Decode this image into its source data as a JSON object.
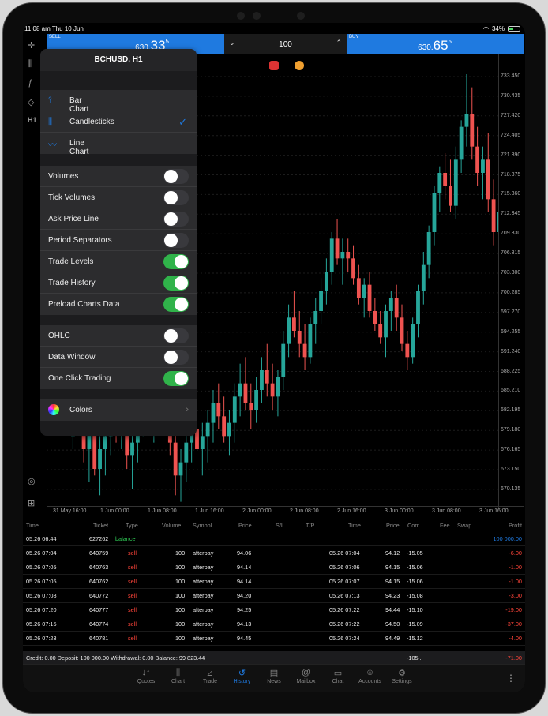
{
  "status": {
    "time": "11:08 am",
    "date": "Thu 10 Jun",
    "battery": "34%"
  },
  "trade": {
    "sell_label": "SELL",
    "sell_small": "630.",
    "sell_big": "33",
    "sell_sup": "5",
    "buy_label": "BUY",
    "buy_small": "630.",
    "buy_big": "65",
    "buy_sup": "5",
    "volume": "100"
  },
  "popover": {
    "title": "BCHUSD, H1",
    "chart_types": [
      {
        "label": "Bar Chart",
        "icon": "bar-chart-icon",
        "selected": false
      },
      {
        "label": "Candlesticks",
        "icon": "candlestick-icon",
        "selected": true
      },
      {
        "label": "Line Chart",
        "icon": "line-chart-icon",
        "selected": false
      }
    ],
    "options": [
      {
        "label": "Volumes",
        "on": false
      },
      {
        "label": "Tick Volumes",
        "on": false
      },
      {
        "label": "Ask Price Line",
        "on": false
      },
      {
        "label": "Period Separators",
        "on": false
      },
      {
        "label": "Trade Levels",
        "on": true
      },
      {
        "label": "Trade History",
        "on": true
      },
      {
        "label": "Preload Charts Data",
        "on": true
      }
    ],
    "options2": [
      {
        "label": "OHLC",
        "on": false
      },
      {
        "label": "Data Window",
        "on": false
      },
      {
        "label": "One Click Trading",
        "on": true
      }
    ],
    "colors_label": "Colors"
  },
  "left_tools": [
    "crosshair-icon",
    "indicators-icon",
    "function-icon",
    "objects-icon",
    "H1"
  ],
  "price_axis": [
    "733.450",
    "730.435",
    "727.420",
    "724.405",
    "721.390",
    "718.375",
    "715.360",
    "712.345",
    "709.330",
    "706.315",
    "703.300",
    "700.285",
    "697.270",
    "694.255",
    "691.240",
    "688.225",
    "685.210",
    "682.195",
    "679.180",
    "676.165",
    "673.150",
    "670.135"
  ],
  "time_axis": [
    "31 May 16:00",
    "1 Jun 00:00",
    "1 Jun 08:00",
    "1 Jun 16:00",
    "2 Jun 00:00",
    "2 Jun 08:00",
    "2 Jun 16:00",
    "3 Jun 00:00",
    "3 Jun 08:00",
    "3 Jun 16:00"
  ],
  "chart_data": {
    "type": "candlestick",
    "symbol": "BCHUSD",
    "timeframe": "H1",
    "ylim": [
      667.0,
      736.0
    ],
    "candles": [
      [
        678,
        684,
        676,
        682
      ],
      [
        682,
        688,
        679,
        681
      ],
      [
        681,
        683,
        674,
        676
      ],
      [
        676,
        680,
        671,
        679
      ],
      [
        679,
        681,
        672,
        673
      ],
      [
        673,
        678,
        669,
        676
      ],
      [
        676,
        680,
        672,
        678
      ],
      [
        678,
        683,
        675,
        680
      ],
      [
        680,
        684,
        677,
        679
      ],
      [
        679,
        682,
        676,
        681
      ],
      [
        681,
        683,
        673,
        675
      ],
      [
        675,
        679,
        670,
        677
      ],
      [
        677,
        681,
        674,
        680
      ],
      [
        680,
        686,
        678,
        684
      ],
      [
        684,
        687,
        680,
        681
      ],
      [
        681,
        685,
        677,
        683
      ],
      [
        683,
        687,
        679,
        685
      ],
      [
        685,
        688,
        681,
        682
      ],
      [
        682,
        684,
        675,
        677
      ],
      [
        677,
        679,
        669,
        672
      ],
      [
        672,
        676,
        668,
        674
      ],
      [
        674,
        679,
        671,
        677
      ],
      [
        677,
        681,
        674,
        679
      ],
      [
        679,
        683,
        675,
        676
      ],
      [
        676,
        680,
        672,
        678
      ],
      [
        678,
        682,
        674,
        680
      ],
      [
        680,
        685,
        677,
        683
      ],
      [
        683,
        686,
        679,
        681
      ],
      [
        681,
        684,
        677,
        678
      ],
      [
        678,
        682,
        675,
        680
      ],
      [
        680,
        686,
        677,
        684
      ],
      [
        684,
        689,
        681,
        686
      ],
      [
        686,
        690,
        682,
        683
      ],
      [
        683,
        686,
        679,
        682
      ],
      [
        682,
        687,
        680,
        685
      ],
      [
        685,
        690,
        683,
        688
      ],
      [
        688,
        692,
        684,
        686
      ],
      [
        686,
        689,
        682,
        684
      ],
      [
        684,
        688,
        681,
        687
      ],
      [
        687,
        694,
        685,
        692
      ],
      [
        692,
        698,
        690,
        696
      ],
      [
        696,
        700,
        693,
        694
      ],
      [
        694,
        697,
        690,
        692
      ],
      [
        692,
        695,
        688,
        690
      ],
      [
        690,
        696,
        689,
        695
      ],
      [
        695,
        699,
        692,
        697
      ],
      [
        697,
        702,
        695,
        700
      ],
      [
        700,
        705,
        698,
        703
      ],
      [
        703,
        709,
        701,
        708
      ],
      [
        708,
        711,
        704,
        705
      ],
      [
        705,
        708,
        701,
        706
      ],
      [
        706,
        708,
        703,
        705
      ],
      [
        705,
        707,
        701,
        702
      ],
      [
        702,
        704,
        698,
        699
      ],
      [
        699,
        702,
        696,
        701
      ],
      [
        701,
        703,
        696,
        697
      ],
      [
        697,
        699,
        694,
        695
      ],
      [
        695,
        697,
        692,
        693
      ],
      [
        693,
        698,
        690,
        697
      ],
      [
        697,
        700,
        694,
        699
      ],
      [
        699,
        701,
        694,
        696
      ],
      [
        696,
        698,
        691,
        692
      ],
      [
        692,
        694,
        688,
        690
      ],
      [
        690,
        696,
        689,
        695
      ],
      [
        695,
        701,
        693,
        700
      ],
      [
        700,
        706,
        698,
        704
      ],
      [
        704,
        710,
        702,
        709
      ],
      [
        709,
        716,
        707,
        715
      ],
      [
        715,
        719,
        712,
        718
      ],
      [
        718,
        721,
        714,
        716
      ],
      [
        716,
        720,
        712,
        713
      ],
      [
        713,
        722,
        711,
        720
      ],
      [
        720,
        726,
        718,
        725
      ],
      [
        725,
        733,
        722,
        727
      ],
      [
        727,
        731,
        720,
        722
      ],
      [
        722,
        725,
        716,
        718
      ],
      [
        718,
        722,
        714,
        720
      ],
      [
        720,
        724,
        712,
        714
      ],
      [
        714,
        717,
        707,
        709
      ],
      [
        709,
        713,
        705,
        712
      ],
      [
        712,
        716,
        708,
        710
      ],
      [
        710,
        717,
        708,
        715
      ]
    ]
  },
  "history": {
    "columns": [
      "Time",
      "Ticket",
      "Type",
      "Volume",
      "Symbol",
      "Price",
      "S/L",
      "T/P",
      "Time",
      "Price",
      "Com...",
      "Fee",
      "Swap",
      "Profit"
    ],
    "balance_row": {
      "time": "05.26 06:44",
      "ticket": "627262",
      "type": "balance",
      "profit": "100 000.00"
    },
    "rows": [
      {
        "time": "05.26 07:04",
        "ticket": "640759",
        "type": "sell",
        "volume": "100",
        "symbol": "afterpay",
        "price": "94.06",
        "ctime": "05.26 07:04",
        "cprice": "94.12",
        "comm": "-15.05",
        "profit": "-6.00"
      },
      {
        "time": "05.26 07:05",
        "ticket": "640763",
        "type": "sell",
        "volume": "100",
        "symbol": "afterpay",
        "price": "94.14",
        "ctime": "05.26 07:06",
        "cprice": "94.15",
        "comm": "-15.06",
        "profit": "-1.00"
      },
      {
        "time": "05.26 07:05",
        "ticket": "640762",
        "type": "sell",
        "volume": "100",
        "symbol": "afterpay",
        "price": "94.14",
        "ctime": "05.26 07:07",
        "cprice": "94.15",
        "comm": "-15.06",
        "profit": "-1.00"
      },
      {
        "time": "05.26 07:08",
        "ticket": "640772",
        "type": "sell",
        "volume": "100",
        "symbol": "afterpay",
        "price": "94.20",
        "ctime": "05.26 07:13",
        "cprice": "94.23",
        "comm": "-15.08",
        "profit": "-3.00"
      },
      {
        "time": "05.26 07:20",
        "ticket": "640777",
        "type": "sell",
        "volume": "100",
        "symbol": "afterpay",
        "price": "94.25",
        "ctime": "05.26 07:22",
        "cprice": "94.44",
        "comm": "-15.10",
        "profit": "-19.00"
      },
      {
        "time": "05.26 07:15",
        "ticket": "640774",
        "type": "sell",
        "volume": "100",
        "symbol": "afterpay",
        "price": "94.13",
        "ctime": "05.26 07:22",
        "cprice": "94.50",
        "comm": "-15.09",
        "profit": "-37.00"
      },
      {
        "time": "05.26 07:23",
        "ticket": "640781",
        "type": "sell",
        "volume": "100",
        "symbol": "afterpay",
        "price": "94.45",
        "ctime": "05.26 07:24",
        "cprice": "94.49",
        "comm": "-15.12",
        "profit": "-4.00"
      }
    ],
    "summary": "Credit: 0.00 Deposit: 100 000.00 Withdrawal: 0.00 Balance: 99 823.44",
    "summary_comm": "-105...",
    "summary_profit": "-71.00"
  },
  "tabs": [
    {
      "label": "Quotes",
      "icon": "quotes-icon",
      "glyph": "↓↑"
    },
    {
      "label": "Chart",
      "icon": "chart-icon",
      "glyph": "⫼"
    },
    {
      "label": "Trade",
      "icon": "trade-icon",
      "glyph": "⊿"
    },
    {
      "label": "History",
      "icon": "history-icon",
      "glyph": "↺",
      "active": true
    },
    {
      "label": "News",
      "icon": "news-icon",
      "glyph": "▤"
    },
    {
      "label": "Mailbox",
      "icon": "mailbox-icon",
      "glyph": "@"
    },
    {
      "label": "Chat",
      "icon": "chat-icon",
      "glyph": "▭"
    },
    {
      "label": "Accounts",
      "icon": "accounts-icon",
      "glyph": "☺"
    },
    {
      "label": "Settings",
      "icon": "settings-icon",
      "glyph": "⚙"
    }
  ],
  "colors": {
    "bull": "#26a69a",
    "bear": "#ef5350",
    "accent": "#1f7ae0",
    "toggle_on": "#30b34a"
  }
}
